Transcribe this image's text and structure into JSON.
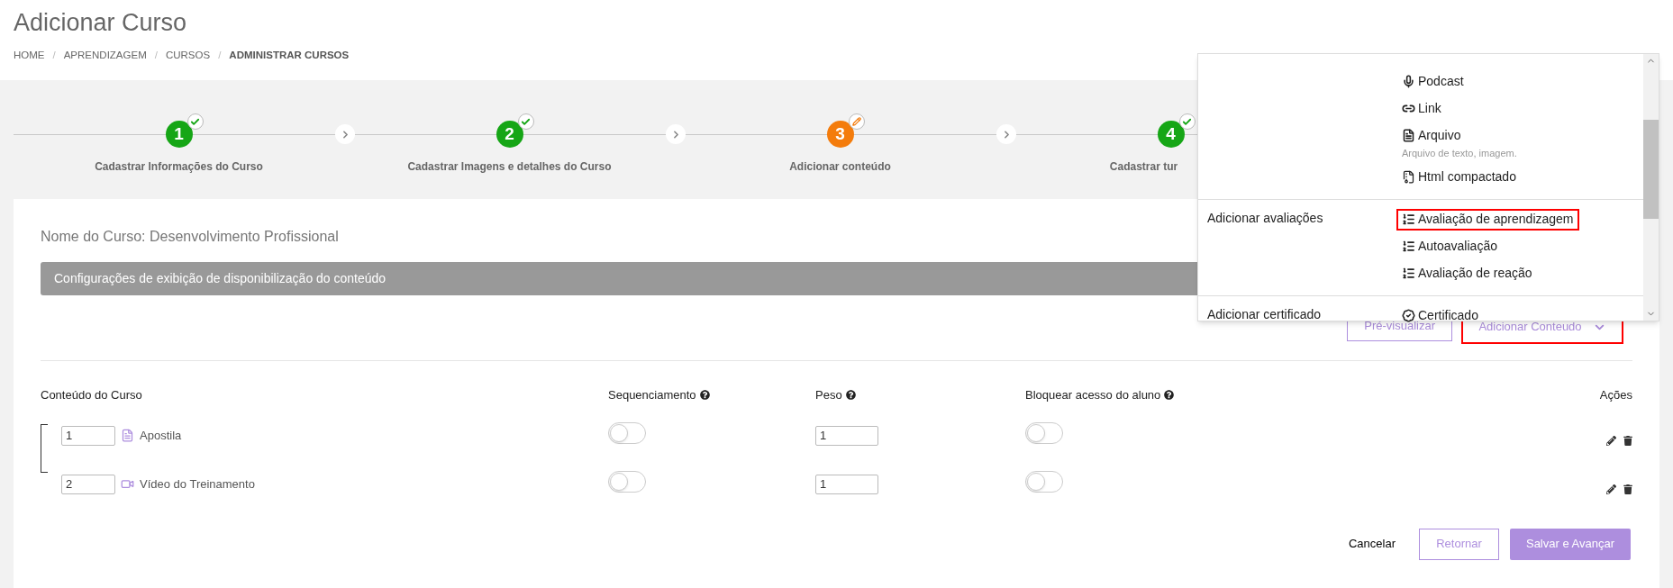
{
  "page_title": "Adicionar Curso",
  "breadcrumb": [
    {
      "label": "HOME",
      "current": false
    },
    {
      "separator": "/",
      "label": "APRENDIZAGEM",
      "current": false
    },
    {
      "separator": "/",
      "label": "CURSOS",
      "current": false
    },
    {
      "separator": "/",
      "label": "ADMINISTRAR CURSOS",
      "current": true
    }
  ],
  "steps": [
    {
      "number": "1",
      "label": "Cadastrar Informações do Curso",
      "done": true
    },
    {
      "number": "2",
      "label": "Cadastrar Imagens e detalhes do Curso",
      "done": true
    },
    {
      "number": "3",
      "label": "Adicionar conteúdo",
      "done": false
    },
    {
      "number": "4",
      "label": "Cadastrar tur",
      "done": true
    }
  ],
  "course_name": "Nome do Curso: Desenvolvimento Profissional",
  "settings_bar": "Configurações de exibição de disponibilização do conteúdo",
  "preview_button": "Pré-visualizar",
  "add_content_button": {
    "label": "Adicionar Conteudo",
    "highlighted": true
  },
  "dropdown": {
    "sections": [
      {
        "items": [
          {
            "kind": "mic",
            "label": "Podcast",
            "highlighted": false
          },
          {
            "kind": "link",
            "label": "Link",
            "highlighted": false
          },
          {
            "kind": "file",
            "label": "Arquivo",
            "description": "Arquivo de texto, imagem.",
            "highlighted": false
          },
          {
            "kind": "zip",
            "label": "Html compactado",
            "highlighted": false
          }
        ]
      },
      {
        "label": "Adicionar avaliações",
        "items": [
          {
            "kind": "list",
            "label": "Avaliação de aprendizagem",
            "highlighted": true
          },
          {
            "kind": "list",
            "label": "Autoavaliação",
            "highlighted": false
          },
          {
            "kind": "list",
            "label": "Avaliação de reação",
            "highlighted": false
          }
        ]
      },
      {
        "label": "Adicionar certificado",
        "items": [
          {
            "kind": "certificate",
            "label": "Certificado",
            "highlighted": false
          }
        ]
      }
    ]
  },
  "table": {
    "columns": [
      {
        "label": "Conteúdo do Curso",
        "help": false
      },
      {
        "label": "Sequenciamento",
        "help": true
      },
      {
        "label": "Peso",
        "help": true
      },
      {
        "label": "Bloquear acesso do aluno",
        "help": true
      },
      {
        "label": "Ações",
        "help": false
      }
    ],
    "rows": [
      {
        "order": "1",
        "kind": "document",
        "title": "Apostila",
        "sequencing": false,
        "weight": "1",
        "block": false
      },
      {
        "order": "2",
        "kind": "video",
        "title": "Vídeo do Treinamento",
        "sequencing": false,
        "weight": "1",
        "block": false
      }
    ]
  },
  "footer": {
    "cancel": "Cancelar",
    "back": "Retornar",
    "save": "Salvar e Avançar"
  }
}
